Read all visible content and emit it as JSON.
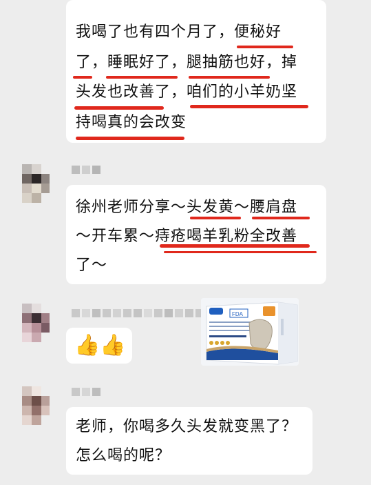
{
  "messages": {
    "msg1": {
      "lines": [
        "我喝了也有四个月了，便秘好",
        "了，睡眠好了，腿抽筋也好，掉",
        "头发也改善了，咱们的小羊奶坚",
        "持喝真的会改变"
      ]
    },
    "msg2": {
      "lines": [
        "徐州老师分享～头发黄～腰肩盘",
        "～开车累～痔疮喝羊乳粉全改善",
        "了～"
      ]
    },
    "msg3": {
      "emoji": "👍👍",
      "product": {
        "brand": "FDA",
        "caption": "羊乳粉"
      }
    },
    "msg4": {
      "lines": [
        "老师，你喝多久头发就变黑了？",
        "怎么喝的呢？"
      ]
    }
  },
  "colors": {
    "background": "#ededed",
    "bubble": "#ffffff",
    "underline": "#e0281c"
  }
}
